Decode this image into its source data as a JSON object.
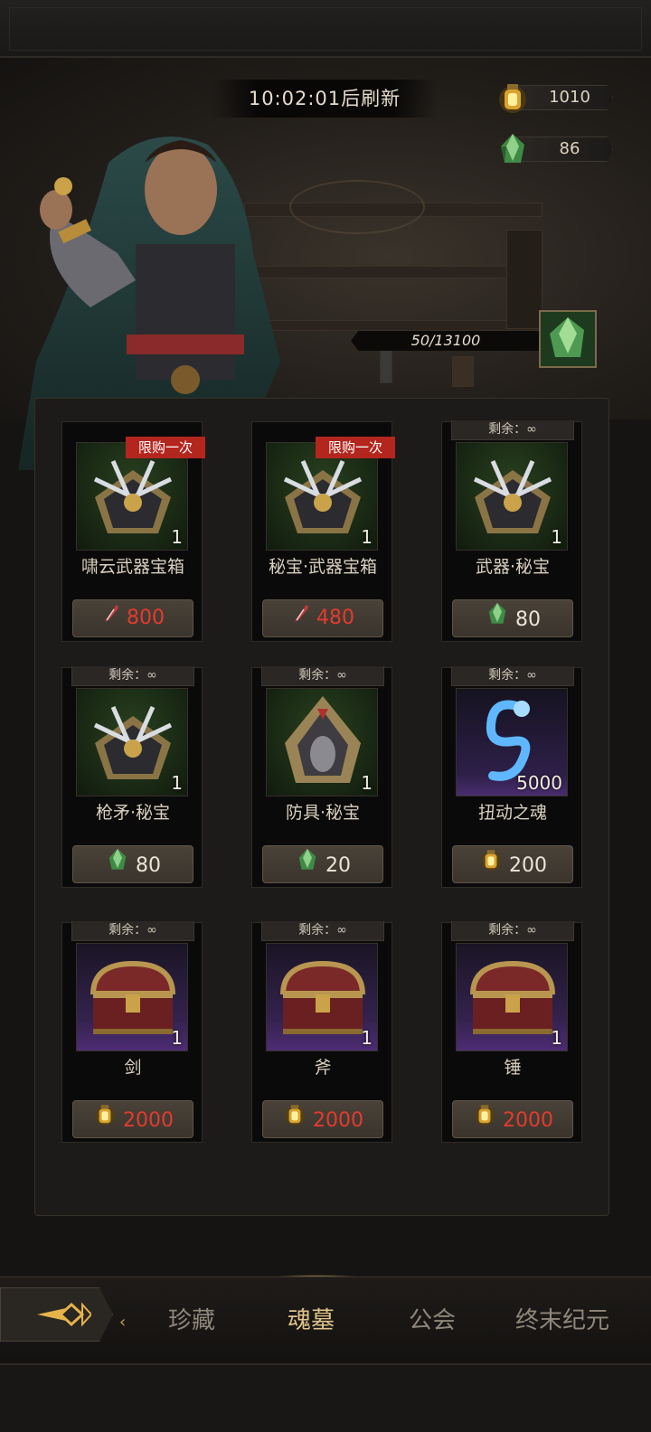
{
  "header": {
    "refresh_timer": "10:02:01后刷新"
  },
  "currencies": [
    {
      "icon": "gold-lantern-icon",
      "value": "1010"
    },
    {
      "icon": "green-crystal-icon",
      "value": "86"
    }
  ],
  "soul_progress": {
    "text": "50/13100",
    "icon": "green-crystal-icon"
  },
  "shop_items": [
    {
      "name": "啸云武器宝箱",
      "qty": "1",
      "limit": "限购一次",
      "remaining": "",
      "price": "800",
      "price_icon": "red-feather-icon",
      "price_color": "#e33b2f",
      "thumb": "weapon-chest-icon"
    },
    {
      "name": "秘宝·武器宝箱",
      "qty": "1",
      "limit": "限购一次",
      "remaining": "",
      "price": "480",
      "price_icon": "red-feather-icon",
      "price_color": "#e33b2f",
      "thumb": "weapon-chest-icon"
    },
    {
      "name": "武器·秘宝",
      "qty": "1",
      "limit": "",
      "remaining": "剩余：∞",
      "price": "80",
      "price_icon": "green-crystal-icon",
      "price_color": "#ece4d6",
      "thumb": "weapon-chest-icon"
    },
    {
      "name": "枪矛·秘宝",
      "qty": "1",
      "limit": "",
      "remaining": "剩余：∞",
      "price": "80",
      "price_icon": "green-crystal-icon",
      "price_color": "#ece4d6",
      "thumb": "weapon-chest-icon"
    },
    {
      "name": "防具·秘宝",
      "qty": "1",
      "limit": "",
      "remaining": "剩余：∞",
      "price": "20",
      "price_icon": "green-crystal-icon",
      "price_color": "#ece4d6",
      "thumb": "armor-chest-icon"
    },
    {
      "name": "扭动之魂",
      "qty": "5000",
      "limit": "",
      "remaining": "剩余：∞",
      "price": "200",
      "price_icon": "gold-lantern-icon",
      "price_color": "#ece4d6",
      "thumb": "blue-soul-icon"
    },
    {
      "name": "剑",
      "qty": "1",
      "limit": "",
      "remaining": "剩余：∞",
      "price": "2000",
      "price_icon": "gold-lantern-icon",
      "price_color": "#e33b2f",
      "thumb": "treasure-chest-icon"
    },
    {
      "name": "斧",
      "qty": "1",
      "limit": "",
      "remaining": "剩余：∞",
      "price": "2000",
      "price_icon": "gold-lantern-icon",
      "price_color": "#e33b2f",
      "thumb": "treasure-chest-icon"
    },
    {
      "name": "锤",
      "qty": "1",
      "limit": "",
      "remaining": "剩余：∞",
      "price": "2000",
      "price_icon": "gold-lantern-icon",
      "price_color": "#e33b2f",
      "thumb": "treasure-chest-icon"
    }
  ],
  "nav": {
    "back_icon": "back-arrow-icon",
    "tabs": [
      {
        "label": "珍藏",
        "active": false
      },
      {
        "label": "魂墓",
        "active": true
      },
      {
        "label": "公会",
        "active": false
      },
      {
        "label": "终末纪元",
        "active": false
      }
    ]
  }
}
